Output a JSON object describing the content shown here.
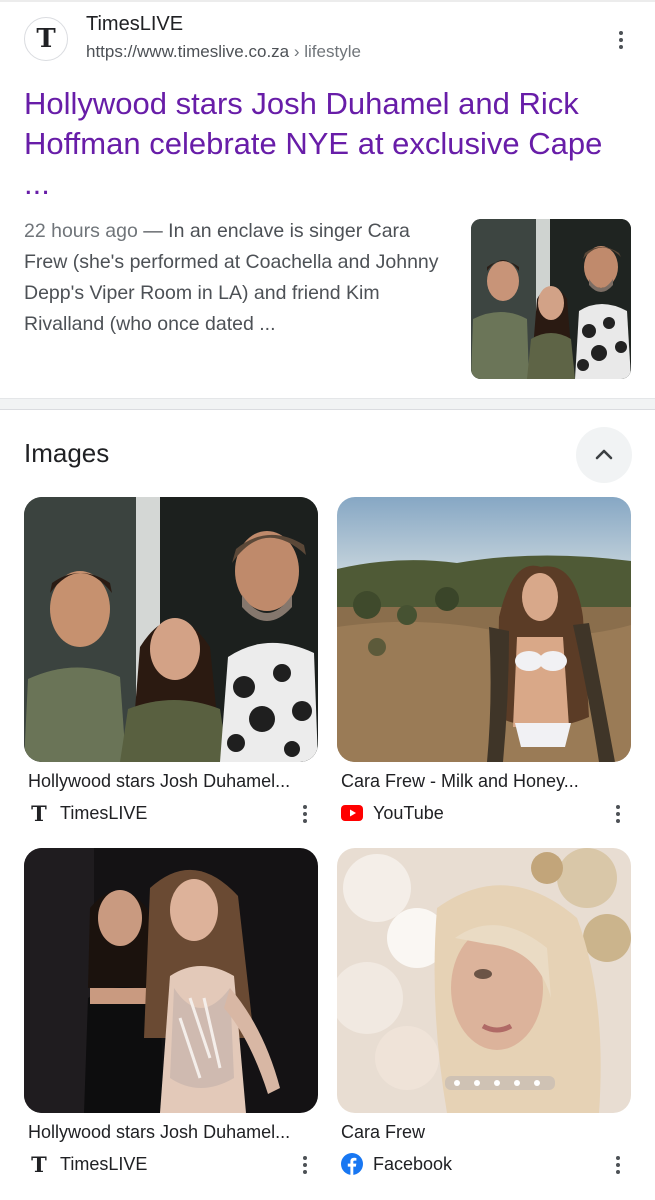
{
  "result": {
    "site_name": "TimesLIVE",
    "url": "https://www.timeslive.co.za",
    "breadcrumb": "› lifestyle",
    "title": "Hollywood stars Josh Duhamel and Rick Hoffman celebrate NYE at exclusive Cape ...",
    "date": "22 hours ago",
    "snippet": " — In an enclave is singer Cara Frew (she's performed at Coachella and Johnny Depp's Viper Room in LA) and friend Kim Rivalland (who once dated ..."
  },
  "images": {
    "heading": "Images",
    "items": [
      {
        "caption": "Hollywood stars Josh Duhamel...",
        "source": "TimesLIVE",
        "source_icon": "timeslive-icon"
      },
      {
        "caption": "Cara Frew - Milk and Honey...",
        "source": "YouTube",
        "source_icon": "youtube-icon"
      },
      {
        "caption": "Hollywood stars Josh Duhamel...",
        "source": "TimesLIVE",
        "source_icon": "timeslive-icon"
      },
      {
        "caption": "Cara Frew",
        "source": "Facebook",
        "source_icon": "facebook-icon"
      }
    ]
  },
  "colors": {
    "visited_link": "#681da8",
    "youtube_red": "#ff0000",
    "facebook_blue": "#1877f2"
  }
}
